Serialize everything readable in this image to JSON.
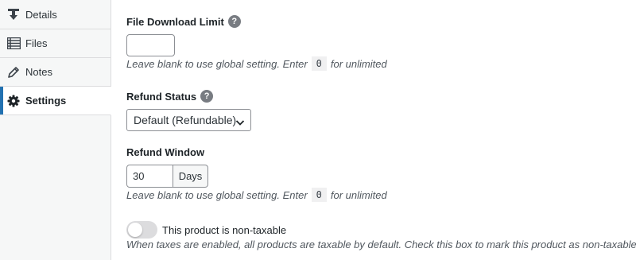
{
  "sidebar": {
    "items": [
      {
        "label": "Details",
        "icon": "download-icon"
      },
      {
        "label": "Files",
        "icon": "list-icon"
      },
      {
        "label": "Notes",
        "icon": "pencil-icon"
      },
      {
        "label": "Settings",
        "icon": "gear-icon",
        "active": true
      }
    ]
  },
  "fields": {
    "download_limit": {
      "title": "File Download Limit",
      "value": "",
      "desc_before": "Leave blank to use global setting. Enter",
      "desc_code": "0",
      "desc_after": "for unlimited"
    },
    "refund_status": {
      "title": "Refund Status",
      "selected": "Default (Refundable)"
    },
    "refund_window": {
      "title": "Refund Window",
      "value": "30",
      "unit": "Days",
      "desc_before": "Leave blank to use global setting. Enter",
      "desc_code": "0",
      "desc_after": "for unlimited"
    },
    "non_taxable": {
      "label": "This product is non-taxable",
      "checked": false,
      "desc": "When taxes are enabled, all products are taxable by default. Check this box to mark this product as non-taxable."
    }
  },
  "help_glyph": "?",
  "colors": {
    "accent": "#2271b1",
    "help_bg": "#787c82",
    "toggle_off": "#dcdcde"
  }
}
